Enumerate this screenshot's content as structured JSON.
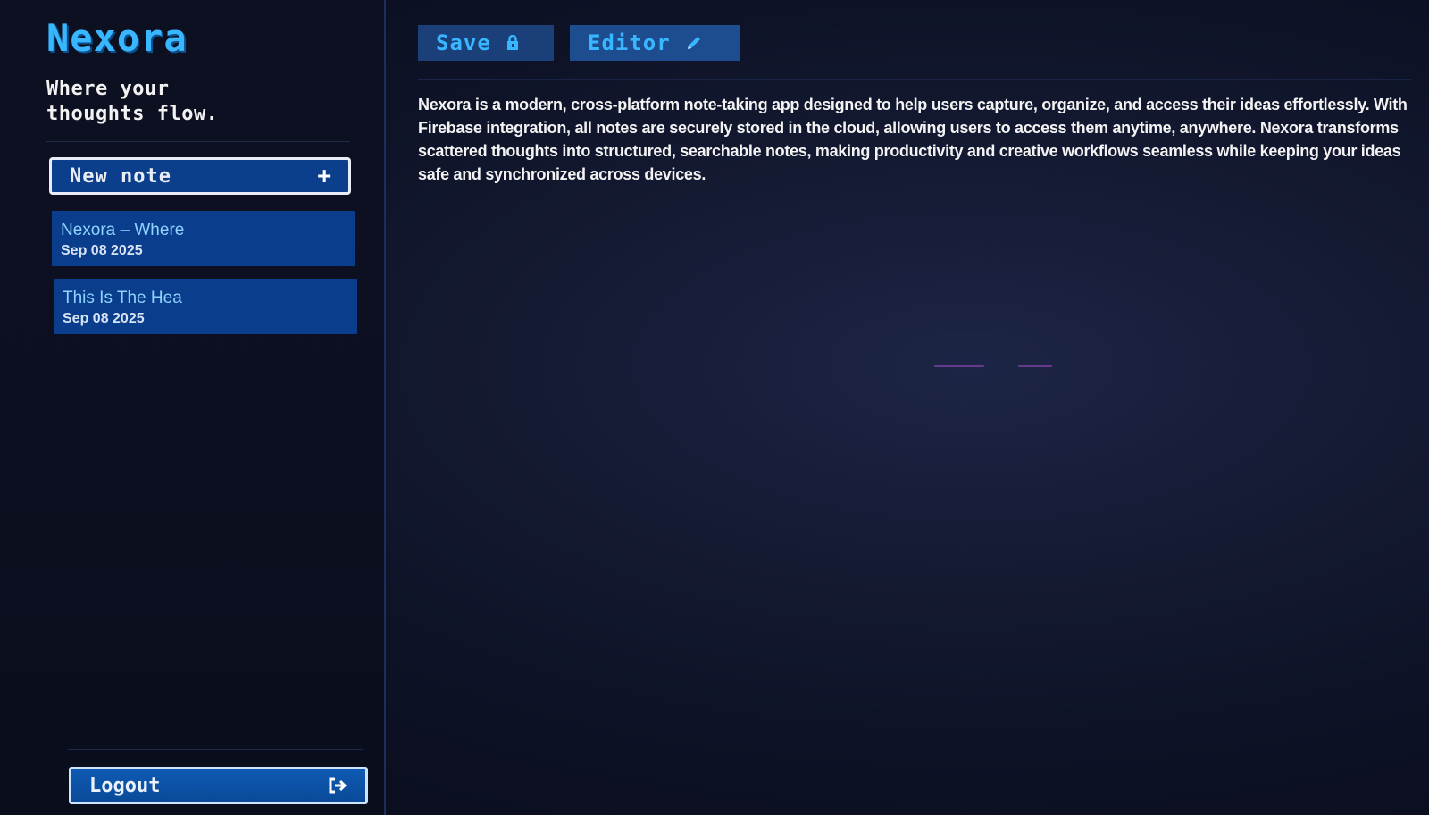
{
  "sidebar": {
    "brand": "Nexora",
    "tagline_line1": "Where your",
    "tagline_line2": "thoughts flow.",
    "new_note_label": "New note",
    "new_note_icon": "plus-icon",
    "notes": [
      {
        "title": "Nexora – Where",
        "date": "Sep 08 2025"
      },
      {
        "title": "This Is The Hea",
        "date": "Sep 08 2025"
      }
    ],
    "logout_label": "Logout",
    "logout_icon": "logout-icon"
  },
  "toolbar": {
    "save_label": "Save",
    "save_icon": "lock-icon",
    "editor_label": "Editor",
    "editor_icon": "pencil-icon"
  },
  "note": {
    "body": "Nexora is a modern, cross-platform note-taking app designed to help users capture, organize, and access their ideas effortlessly. With Firebase integration, all notes are securely stored in the cloud, allowing users to access them anytime, anywhere. Nexora transforms scattered thoughts into structured, searchable notes, making productivity and creative workflows seamless while keeping your ideas safe and synchronized across devices."
  },
  "colors": {
    "accent": "#38b6ff",
    "button_bg": "#0a3d8c",
    "background": "#0b0f1d"
  }
}
